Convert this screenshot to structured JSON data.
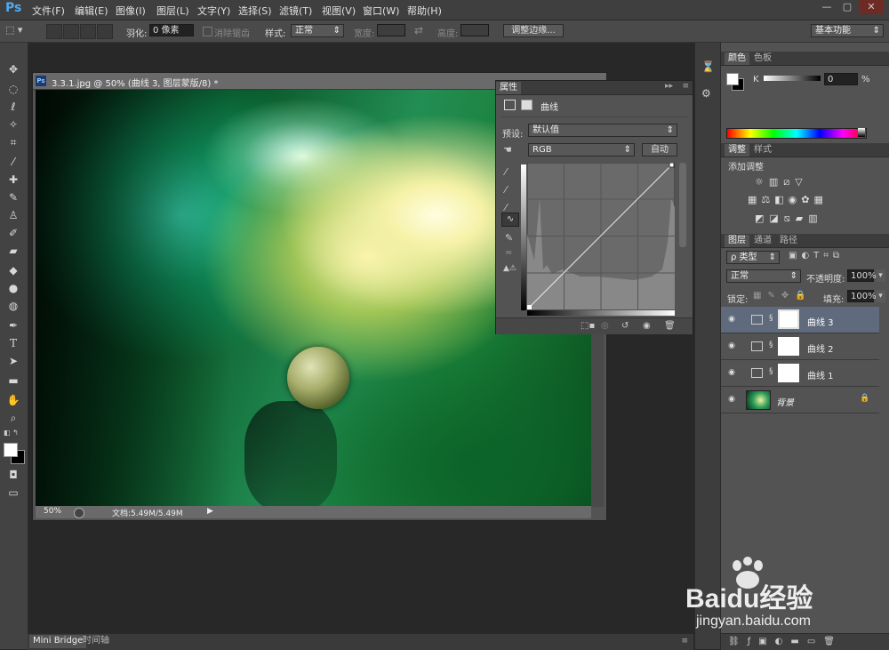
{
  "app": {
    "logo": "Ps"
  },
  "menu": [
    "文件(F)",
    "编辑(E)",
    "图像(I)",
    "图层(L)",
    "文字(Y)",
    "选择(S)",
    "滤镜(T)",
    "视图(V)",
    "窗口(W)",
    "帮助(H)"
  ],
  "window_controls": {
    "minimize": "—",
    "restore": "▢",
    "close": "✕"
  },
  "options": {
    "feather_label": "羽化:",
    "feather_value": "0 像素",
    "antialias_label": "消除锯齿",
    "style_label": "样式:",
    "style_value": "正常",
    "width_label": "宽度:",
    "height_label": "高度:",
    "refine_edge": "调整边缘...",
    "workspace": "基本功能"
  },
  "document": {
    "badge": "Ps",
    "title": "3.3.1.jpg @ 50% (曲线 3, 图层蒙版/8) *",
    "zoom": "50%",
    "doc_size": "文档:5.49M/5.49M"
  },
  "properties": {
    "title": "属性",
    "type": "曲线",
    "preset_label": "预设:",
    "preset_value": "默认值",
    "channel": "RGB",
    "auto": "自动"
  },
  "color_panel": {
    "tabs": [
      "颜色",
      "色板"
    ],
    "channel": "K",
    "value": "0",
    "unit": "%"
  },
  "adjustments_panel": {
    "tabs": [
      "调整",
      "样式"
    ],
    "add_label": "添加调整"
  },
  "layers_panel": {
    "tabs": [
      "图层",
      "通道",
      "路径"
    ],
    "filter_label": "ρ 类型",
    "blend_mode": "正常",
    "opacity_label": "不透明度:",
    "opacity_value": "100%",
    "lock_label": "锁定:",
    "fill_label": "填充:",
    "fill_value": "100%",
    "layers": [
      {
        "name": "曲线 3",
        "selected": true
      },
      {
        "name": "曲线 2",
        "selected": false
      },
      {
        "name": "曲线 1",
        "selected": false
      },
      {
        "name": "背景",
        "selected": false
      }
    ]
  },
  "bottom_tabs": [
    "Mini Bridge",
    "时间轴"
  ],
  "watermark": {
    "brand": "Baidu经验",
    "url": "jingyan.baidu.com"
  },
  "colors": {
    "accent": "#4fa9f2",
    "selected_row": "#5f6a7c"
  }
}
